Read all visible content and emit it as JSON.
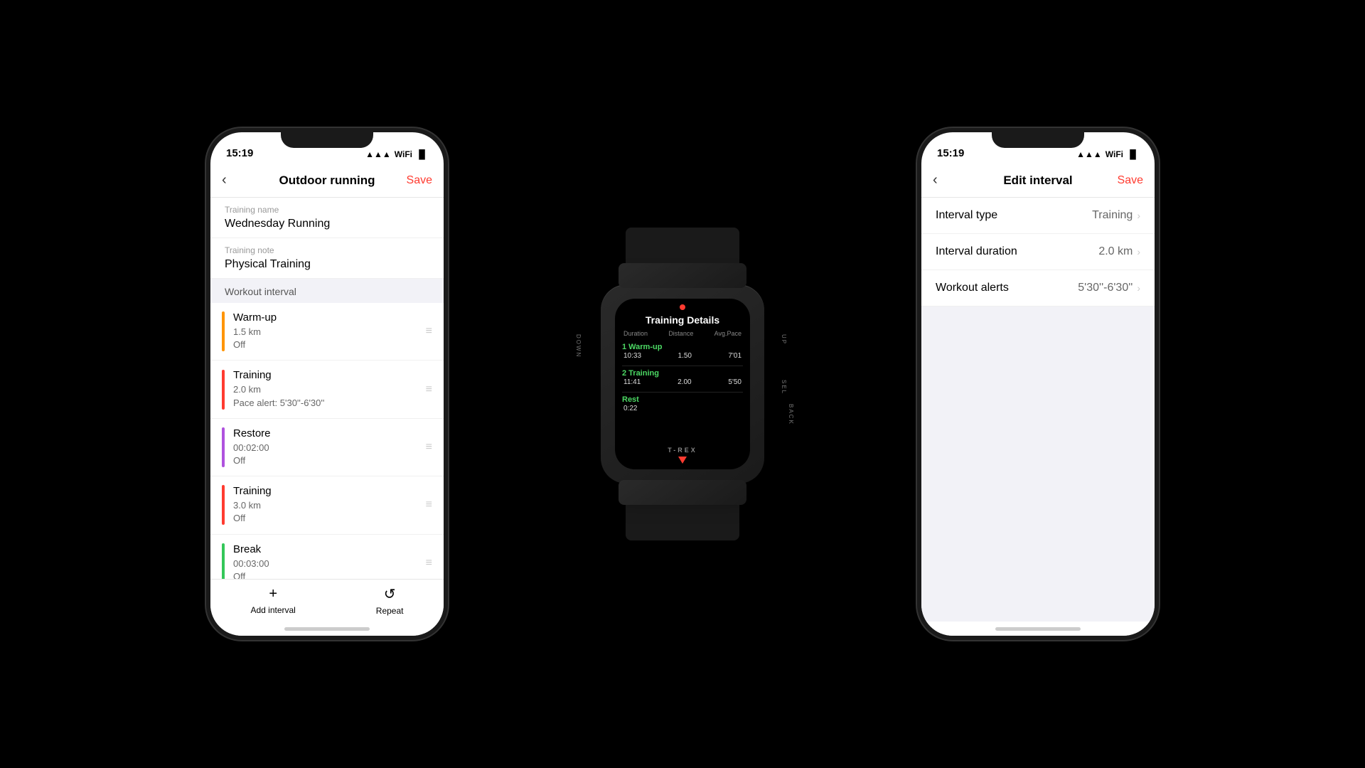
{
  "leftPhone": {
    "statusBar": {
      "time": "15:19",
      "icons": "▲ WiFi Battery"
    },
    "navTitle": "Outdoor running",
    "navSave": "Save",
    "trainingNameLabel": "Training name",
    "trainingNameValue": "Wednesday Running",
    "trainingNoteLabel": "Training note",
    "trainingNoteValue": "Physical Training",
    "sectionHeader": "Workout interval",
    "intervals": [
      {
        "name": "Warm-up",
        "detail1": "1.5 km",
        "detail2": "Off",
        "color": "#FF9500"
      },
      {
        "name": "Training",
        "detail1": "2.0 km",
        "detail2": "Pace alert: 5'30''-6'30''",
        "color": "#FF3B30"
      },
      {
        "name": "Restore",
        "detail1": "00:02:00",
        "detail2": "Off",
        "color": "#AF52DE"
      },
      {
        "name": "Training",
        "detail1": "3.0 km",
        "detail2": "Off",
        "color": "#FF3B30"
      },
      {
        "name": "Break",
        "detail1": "00:03:00",
        "detail2": "Off",
        "color": "#34C759"
      }
    ],
    "toolbar": {
      "addLabel": "Add interval",
      "repeatLabel": "Repeat"
    }
  },
  "rightPhone": {
    "statusBar": {
      "time": "15:19"
    },
    "navTitle": "Edit interval",
    "navSave": "Save",
    "rows": [
      {
        "label": "Interval type",
        "value": "Training"
      },
      {
        "label": "Interval duration",
        "value": "2.0 km"
      },
      {
        "label": "Workout alerts",
        "value": "5'30''-6'30''"
      }
    ]
  },
  "watch": {
    "title": "Training Details",
    "headers": [
      "Duration",
      "Distance",
      "Avg.Pace"
    ],
    "rows": [
      {
        "label": "1 Warm-up",
        "values": [
          "10:33",
          "1.50",
          "7'01"
        ]
      },
      {
        "label": "2 Training",
        "values": [
          "11:41",
          "2.00",
          "5'50"
        ]
      },
      {
        "label": "Rest",
        "values": [
          "0:22",
          "",
          ""
        ]
      }
    ],
    "brand": "T-REX",
    "sideLabels": [
      "UP",
      "SEL",
      "DOWN",
      "BACK"
    ]
  }
}
